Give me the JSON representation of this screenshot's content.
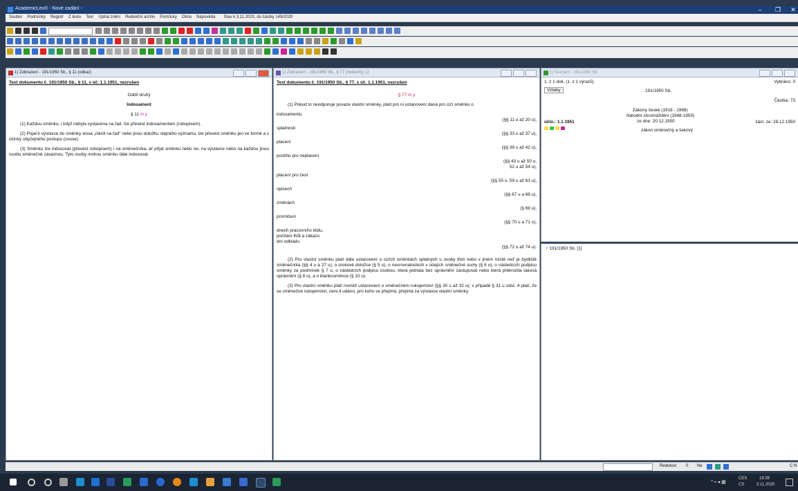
{
  "window": {
    "title": "AcademicLex® - Nové zadání -",
    "minimize": "–",
    "maximize": "❐",
    "close": "✕"
  },
  "menu": [
    "Soubor",
    "Podmínky",
    "Registr",
    "Z textu",
    "Text",
    "Úplná znění",
    "Redukční archiv",
    "Pomůcky",
    "Okno",
    "Nápověda",
    "Stav k 3.11.2020, do částky 149/2020"
  ],
  "pane1": {
    "header": "1) Zobrazení - 191/1950 Sb., § 11 (odkaz)",
    "title": "Text dokumentu č. 191/1950 Sb., § 11, s úč. 1.1.1951, nezrušen",
    "part": "Oddíl druhý",
    "heading": "Indosament",
    "section": "§ 11",
    "sec_mark": "m y",
    "p1": "(1) Každou směnku, i když nebyla vystavena na řad, lze převést indosamentem (rubopisem).",
    "p2": "(2) Pojal-li výstavce do směnky slova „nikoli na řad\" nebo jinou doložku stejného významu, lze převést směnku jen ve formě a s účinky obyčejného postupu (cesse).",
    "p3": "(3) Směnku lze indosovat (převést rubopisem) i na směnečníka, ať přijal směnku nebo ne, na výstavce nebo na každou jinou osobu směnečně závaznou. Tyto osoby mohou směnku dále indosovat."
  },
  "pane2": {
    "header": "1) Zobrazení - 191/1950 Sb., § 77 (nebezný) 1)",
    "title": "Text dokumentu č. 191/1950 Sb., § 77, s úč. 1.1.1951, nezrušen",
    "section": "§ 77",
    "sec_mark": "m y",
    "intro": "(1) Pokud to neodporuje povaze vlastní směnky, platí pro ni ustanovení daná pro cizí směnku o",
    "items": [
      {
        "label": "indosamentu",
        "ref": "(§§ 11 u až 20 u),"
      },
      {
        "label": "splatnosti",
        "ref": "(§§ 33 u až 37 u),"
      },
      {
        "label": "placení",
        "ref": "(§§ 38 u až 42 u),"
      },
      {
        "label": "postihu pro neplacení",
        "ref": "(§§ 43 u až 50 u,",
        "ref2": "52 u až 54 u),"
      },
      {
        "label": "placení pro čest",
        "ref": "(§§ 55 u, 59 u až 63 u),"
      },
      {
        "label": "opisech",
        "ref": "(§§ 67 u a 68 u),"
      },
      {
        "label": "změnách",
        "ref": "(§ 69 u),"
      },
      {
        "label": "promlčení",
        "ref": "(§§ 70 u a 71 u),"
      },
      {
        "label": "dnech pracovního klidu, počítání lhůt a zákazu dní odkladu",
        "ref": "(§§ 72 u až 74 u)."
      }
    ],
    "p2": "(2) Pro vlastní směnku platí dále ustanovení o cizích směnkách splatných u osoby třetí nebo v jiném místě než je bydliště směnečníka (§§ 4 u a 27 u), o úrokové doložce (§ 5 u), o nesrovnalostech v údajích směnečné sumy (§ 6 u), o následcích podpisu směnky za podmínek § 7 u, o následcích podpisu osobou, která jednala bez oprávnění zastupovat nebo která překročila taková oprávnění (§ 8 u), a o blankosměnce (§ 10 u).",
    "p3": "(3) Pro vlastní směnku platí rovněž ustanovení o směnečném rukojemství (§§ 30 u až 32 u); v případě § 31 u odst. 4 platí, že se směnečné rukojemství, není-li udáno, pro koho se přejímá, přejímá za výstavce vlastní směnky."
  },
  "pane3": {
    "header": "1) Seznam - 191/1950 Sb.",
    "count": "1. z 1 dok. (1. z 1 výrazů)",
    "selected": "Vybráno: 0",
    "relations": "Vztahy",
    "docnum": "191/1950 Sb.",
    "amount": "Částka: 73",
    "coll1": "Zákony české (1918 - 1968)",
    "coll2": "Národní shromáždění (1948-1959)",
    "date": "ze dne: 20.12.1950",
    "effective": "účin.: 1.1.1951",
    "part": "část. ze: 28.12.1950",
    "name": "zákon směnečný a šekový",
    "tree_item": "191/1950 Sb. [1]"
  },
  "status": {
    "reduction": "Redukce:",
    "reduction_val": "0",
    "ne": "Ne",
    "cn": "C N"
  },
  "taskbar": {
    "lang": "CES",
    "lang2": "CS",
    "time": "18:39",
    "date": "3.11.2020"
  }
}
